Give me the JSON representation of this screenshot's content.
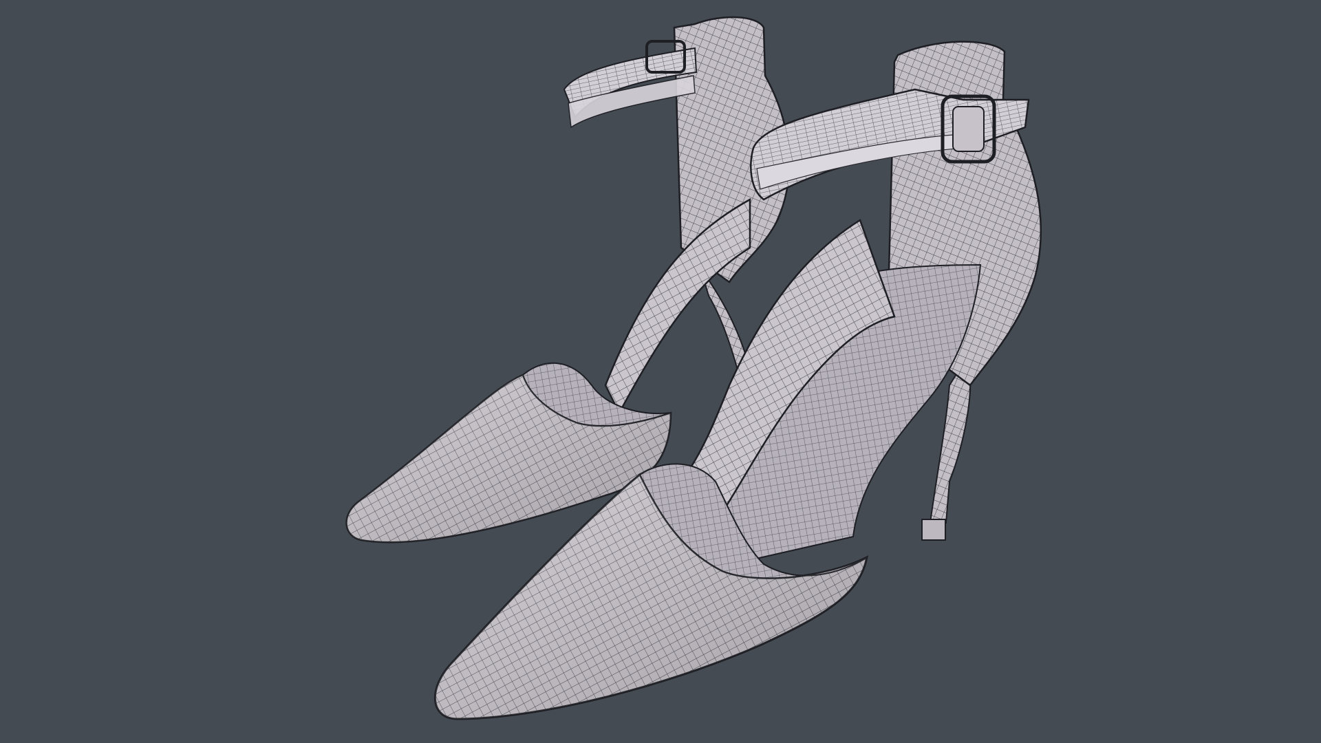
{
  "viewport": {
    "background_color": "#454b53",
    "subject": "wireframe-high-heel-pair",
    "colors": {
      "shell": "#c9c4cb",
      "inner": "#b9b4bc",
      "wire": "#4a4a52",
      "edge": "#1e1f24",
      "highlight": "#e2dee4"
    }
  }
}
